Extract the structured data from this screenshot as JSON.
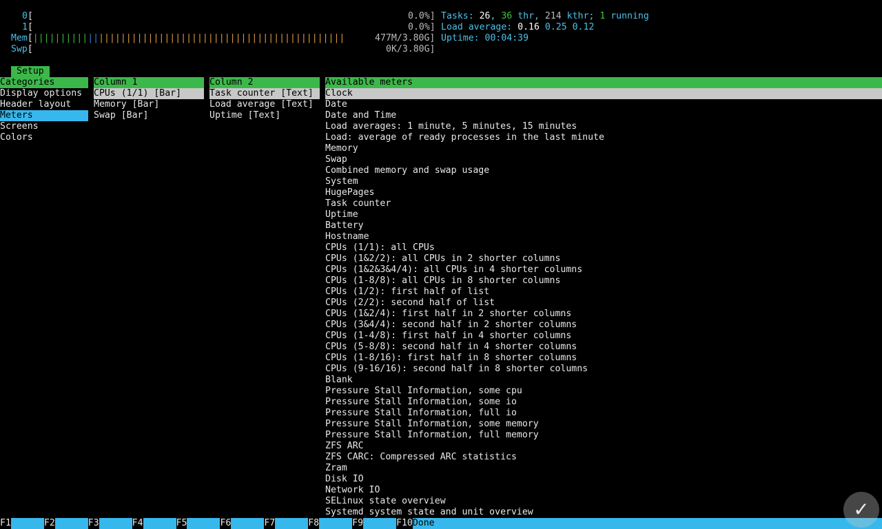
{
  "meters": {
    "cpu0": {
      "label": "0",
      "value": "0.0%]"
    },
    "cpu1": {
      "label": "1",
      "value": "0.0%]"
    },
    "mem": {
      "label": "Mem",
      "value": "477M/3.80G]"
    },
    "swp": {
      "label": "Swp",
      "value": "0K/3.80G]"
    },
    "tasks": {
      "label": "Tasks: ",
      "count": "26",
      "sep1": ", ",
      "thr": "36",
      "thr_label": " thr",
      "sep2": ", ",
      "kthr": "214",
      "kthr_label": " kthr",
      "sep3": "; ",
      "running": "1",
      "running_label": " running"
    },
    "load": {
      "label": "Load average: ",
      "v1": "0.16",
      "v2": "0.25",
      "v3": "0.12"
    },
    "uptime": {
      "label": "Uptime: ",
      "value": "00:04:39"
    }
  },
  "setup_tab": "Setup",
  "categories": {
    "header": "Categories",
    "items": [
      "Display options",
      "Header layout",
      "Meters",
      "Screens",
      "Colors"
    ],
    "selected_index": 2
  },
  "column1": {
    "header": "Column 1",
    "items": [
      "CPUs (1/1) [Bar]",
      "Memory [Bar]",
      "Swap [Bar]"
    ]
  },
  "column2": {
    "header": "Column 2",
    "items": [
      "Task counter [Text]",
      "Load average [Text]",
      "Uptime [Text]"
    ]
  },
  "available": {
    "header": "Available meters",
    "items": [
      "Clock",
      "Date",
      "Date and Time",
      "Load averages: 1 minute, 5 minutes, 15 minutes",
      "Load: average of ready processes in the last minute",
      "Memory",
      "Swap",
      "Combined memory and swap usage",
      "System",
      "HugePages",
      "Task counter",
      "Uptime",
      "Battery",
      "Hostname",
      "CPUs (1/1): all CPUs",
      "CPUs (1&2/2): all CPUs in 2 shorter columns",
      "CPUs (1&2&3&4/4): all CPUs in 4 shorter columns",
      "CPUs (1-8/8): all CPUs in 8 shorter columns",
      "CPUs (1/2): first half of list",
      "CPUs (2/2): second half of list",
      "CPUs (1&2/4): first half in 2 shorter columns",
      "CPUs (3&4/4): second half in 2 shorter columns",
      "CPUs (1-4/8): first half in 4 shorter columns",
      "CPUs (5-8/8): second half in 4 shorter columns",
      "CPUs (1-8/16): first half in 8 shorter columns",
      "CPUs (9-16/16): second half in 8 shorter columns",
      "Blank",
      "Pressure Stall Information, some cpu",
      "Pressure Stall Information, some io",
      "Pressure Stall Information, full io",
      "Pressure Stall Information, some memory",
      "Pressure Stall Information, full memory",
      "ZFS ARC",
      "ZFS CARC: Compressed ARC statistics",
      "Zram",
      "Disk IO",
      "Network IO",
      "SELinux state overview",
      "Systemd system state and unit overview"
    ]
  },
  "function_keys": [
    {
      "key": "F1",
      "label": ""
    },
    {
      "key": "F2",
      "label": ""
    },
    {
      "key": "F3",
      "label": ""
    },
    {
      "key": "F4",
      "label": ""
    },
    {
      "key": "F5",
      "label": ""
    },
    {
      "key": "F6",
      "label": ""
    },
    {
      "key": "F7",
      "label": ""
    },
    {
      "key": "F8",
      "label": ""
    },
    {
      "key": "F9",
      "label": ""
    },
    {
      "key": "F10",
      "label": "Done"
    }
  ],
  "colors": {
    "header_green": "#3cb84a",
    "selection_cyan": "#37b8ec",
    "selection_gray": "#c8c8c8",
    "text_cyan": "#4cc0e8",
    "text_green": "#3cc83c"
  },
  "watermark_icon": "logo-icon"
}
